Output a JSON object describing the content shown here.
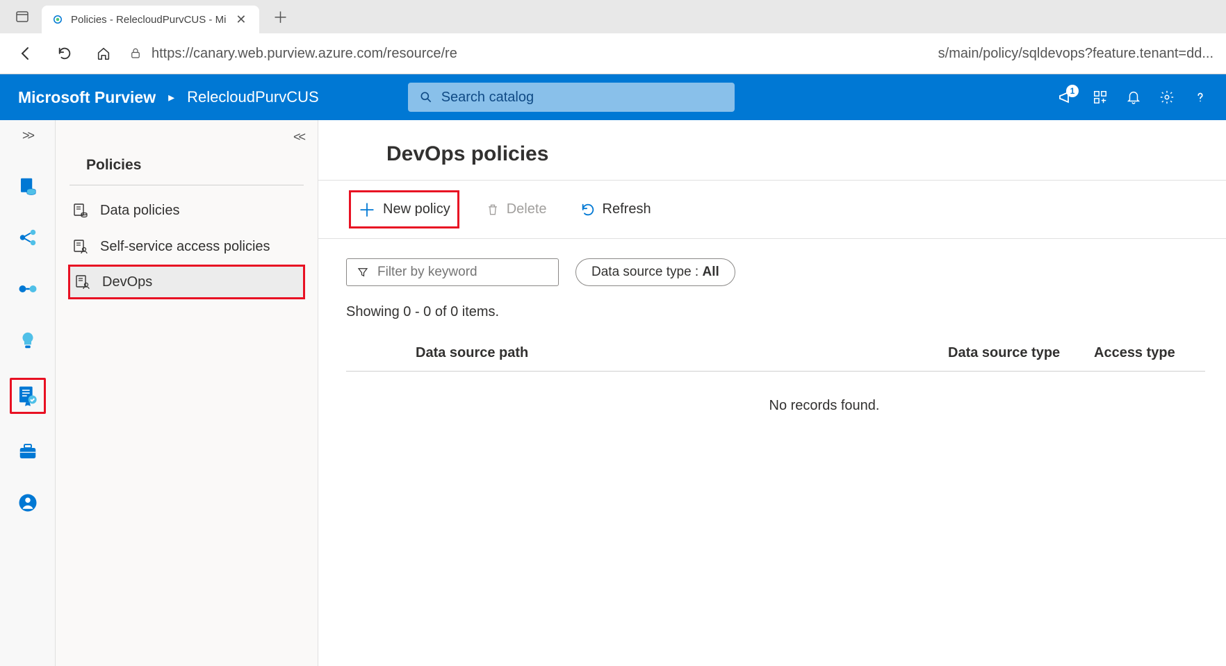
{
  "browser": {
    "tab_title": "Policies - RelecloudPurvCUS - Mi",
    "url_left": "https://canary.web.purview.azure.com/resource/re",
    "url_right": "s/main/policy/sqldevops?feature.tenant=dd..."
  },
  "header": {
    "product": "Microsoft Purview",
    "breadcrumb": "RelecloudPurvCUS",
    "search_placeholder": "Search catalog",
    "notification_count": "1"
  },
  "side_panel": {
    "title": "Policies",
    "items": [
      {
        "label": "Data policies"
      },
      {
        "label": "Self-service access policies"
      },
      {
        "label": "DevOps"
      }
    ]
  },
  "content": {
    "title": "DevOps policies",
    "toolbar": {
      "new_policy": "New policy",
      "delete": "Delete",
      "refresh": "Refresh"
    },
    "filter": {
      "placeholder": "Filter by keyword",
      "pill_label": "Data source type : ",
      "pill_value": "All"
    },
    "showing": "Showing 0 - 0 of 0 items.",
    "columns": {
      "path": "Data source path",
      "type": "Data source type",
      "access": "Access type"
    },
    "empty": "No records found."
  }
}
